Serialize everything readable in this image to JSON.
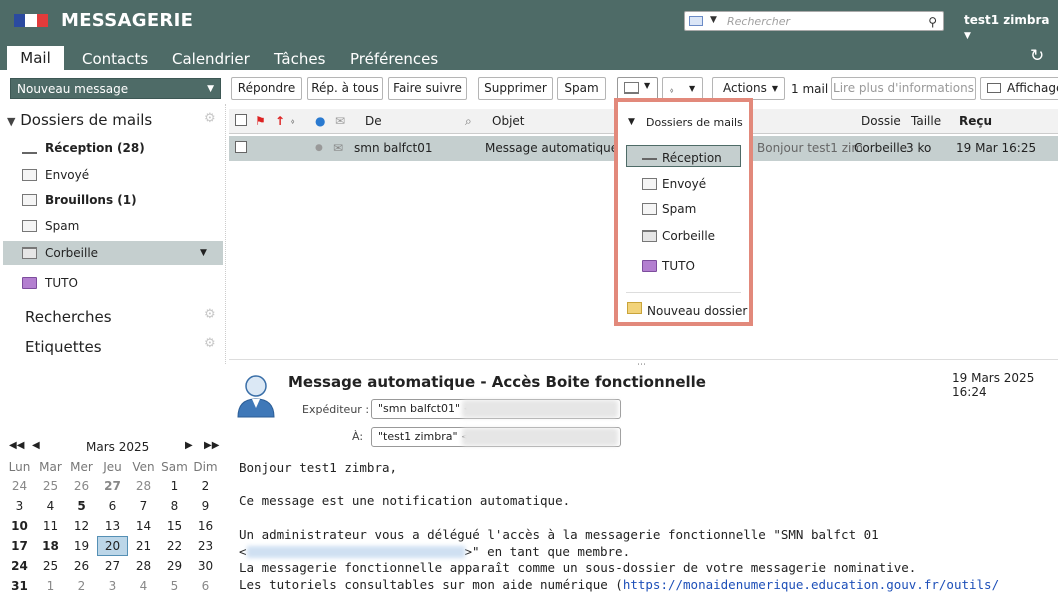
{
  "header": {
    "app_title": "MESSAGERIE",
    "search_placeholder": "Rechercher",
    "user": "test1 zimbra",
    "tabs": [
      "Mail",
      "Contacts",
      "Calendrier",
      "Tâches",
      "Préférences"
    ],
    "active_tab": "Mail"
  },
  "toolbar": {
    "new_message": "Nouveau message",
    "reply": "Répondre",
    "reply_all": "Rép. à tous",
    "forward": "Faire suivre",
    "delete": "Supprimer",
    "spam": "Spam",
    "actions": "Actions",
    "mail_count": "1 mail",
    "read_more": "Lire plus d'informations",
    "display": "Affichage"
  },
  "sidebar": {
    "folders_title": "Dossiers de mails",
    "folders": [
      {
        "label": "Réception (28)",
        "icon": "inbox-icon",
        "bold": true
      },
      {
        "label": "Envoyé",
        "icon": "sent-icon",
        "bold": false
      },
      {
        "label": "Brouillons (1)",
        "icon": "drafts-icon",
        "bold": true
      },
      {
        "label": "Spam",
        "icon": "spam-icon",
        "bold": false
      },
      {
        "label": "Corbeille",
        "icon": "trash-icon",
        "bold": false,
        "selected": true
      },
      {
        "label": "TUTO",
        "icon": "folder-icon",
        "bold": false
      }
    ],
    "searches_title": "Recherches",
    "tags_title": "Etiquettes"
  },
  "list": {
    "headers": {
      "from": "De",
      "subject": "Objet",
      "folder": "Dossie",
      "size": "Taille",
      "received": "Reçu"
    },
    "rows": [
      {
        "from": "smn balfct01",
        "subject": "Message automatique -",
        "preview": "Bonjour test1 zim",
        "folder": "Corbeille",
        "size": "3 ko",
        "received": "19 Mar 16:25"
      }
    ]
  },
  "move_menu": {
    "title": "Dossiers de mails",
    "items": [
      "Réception",
      "Envoyé",
      "Spam",
      "Corbeille",
      "TUTO"
    ],
    "new_folder": "Nouveau dossier"
  },
  "message": {
    "subject": "Message automatique - Accès Boite fonctionnelle",
    "date": "19 Mars 2025 16:24",
    "from_label": "Expéditeur :",
    "from_value": "\"smn balfct01\" <",
    "to_label": "À:",
    "to_value": "\"test1 zimbra\" <",
    "body_lines": [
      "Bonjour test1 zimbra,",
      "",
      "Ce message est une notification automatique.",
      "",
      "Un administrateur vous a délégué l'accès à la messagerie fonctionnelle \"SMN balfct 01",
      ">\" en tant que membre.",
      "La messagerie fonctionnelle apparaît comme un sous-dossier de votre messagerie nominative.",
      "Les tutoriels consultables sur mon aide numérique ("
    ],
    "body_link": "https://monaidenumerique.education.gouv.fr/outils/"
  },
  "calendar": {
    "month": "Mars 2025",
    "weekdays": [
      "Lun",
      "Mar",
      "Mer",
      "Jeu",
      "Ven",
      "Sam",
      "Dim"
    ],
    "weeks": [
      [
        "24",
        "25",
        "26",
        "27",
        "28",
        "1",
        "2"
      ],
      [
        "3",
        "4",
        "5",
        "6",
        "7",
        "8",
        "9"
      ],
      [
        "10",
        "11",
        "12",
        "13",
        "14",
        "15",
        "16"
      ],
      [
        "17",
        "18",
        "19",
        "20",
        "21",
        "22",
        "23"
      ],
      [
        "24",
        "25",
        "26",
        "27",
        "28",
        "29",
        "30"
      ],
      [
        "31",
        "1",
        "2",
        "3",
        "4",
        "5",
        "6"
      ]
    ],
    "today": "20"
  }
}
